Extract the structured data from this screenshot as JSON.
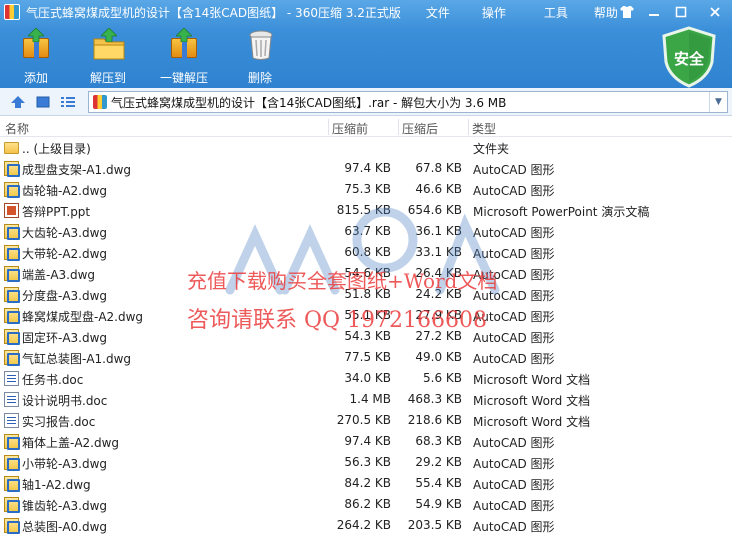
{
  "window": {
    "title": "气压式蜂窝煤成型机的设计【含14张CAD图纸】 - 360压缩 3.2正式版",
    "menu": [
      "文件",
      "操作",
      "工具",
      "帮助"
    ]
  },
  "toolbar": {
    "add_label": "添加",
    "extract_label": "解压到",
    "one_click_label": "一键解压",
    "delete_label": "删除",
    "security_label": "安全"
  },
  "addressbar": {
    "path": "气压式蜂窝煤成型机的设计【含14张CAD图纸】.rar - 解包大小为 3.6 MB"
  },
  "columns": {
    "name": "名称",
    "size": "压缩前",
    "packed": "压缩后",
    "type": "类型"
  },
  "files": [
    {
      "icon": "folder",
      "name": ".. (上级目录)",
      "size": "",
      "packed": "",
      "type": "文件夹"
    },
    {
      "icon": "dwg",
      "name": "成型盘支架-A1.dwg",
      "size": "97.4 KB",
      "packed": "67.8 KB",
      "type": "AutoCAD 图形"
    },
    {
      "icon": "dwg",
      "name": "齿轮轴-A2.dwg",
      "size": "75.3 KB",
      "packed": "46.6 KB",
      "type": "AutoCAD 图形"
    },
    {
      "icon": "ppt",
      "name": "答辩PPT.ppt",
      "size": "815.5 KB",
      "packed": "654.6 KB",
      "type": "Microsoft PowerPoint 演示文稿"
    },
    {
      "icon": "dwg",
      "name": "大齿轮-A3.dwg",
      "size": "63.7 KB",
      "packed": "36.1 KB",
      "type": "AutoCAD 图形"
    },
    {
      "icon": "dwg",
      "name": "大带轮-A2.dwg",
      "size": "60.8 KB",
      "packed": "33.1 KB",
      "type": "AutoCAD 图形"
    },
    {
      "icon": "dwg",
      "name": "端盖-A3.dwg",
      "size": "54.6 KB",
      "packed": "26.4 KB",
      "type": "AutoCAD 图形"
    },
    {
      "icon": "dwg",
      "name": "分度盘-A3.dwg",
      "size": "51.8 KB",
      "packed": "24.2 KB",
      "type": "AutoCAD 图形"
    },
    {
      "icon": "dwg",
      "name": "蜂窝煤成型盘-A2.dwg",
      "size": "55.1 KB",
      "packed": "27.9 KB",
      "type": "AutoCAD 图形"
    },
    {
      "icon": "dwg",
      "name": "固定环-A3.dwg",
      "size": "54.3 KB",
      "packed": "27.2 KB",
      "type": "AutoCAD 图形"
    },
    {
      "icon": "dwg",
      "name": "气缸总装图-A1.dwg",
      "size": "77.5 KB",
      "packed": "49.0 KB",
      "type": "AutoCAD 图形"
    },
    {
      "icon": "doc",
      "name": "任务书.doc",
      "size": "34.0 KB",
      "packed": "5.6 KB",
      "type": "Microsoft Word 文档"
    },
    {
      "icon": "doc",
      "name": "设计说明书.doc",
      "size": "1.4 MB",
      "packed": "468.3 KB",
      "type": "Microsoft Word 文档"
    },
    {
      "icon": "doc",
      "name": "实习报告.doc",
      "size": "270.5 KB",
      "packed": "218.6 KB",
      "type": "Microsoft Word 文档"
    },
    {
      "icon": "dwg",
      "name": "箱体上盖-A2.dwg",
      "size": "97.4 KB",
      "packed": "68.3 KB",
      "type": "AutoCAD 图形"
    },
    {
      "icon": "dwg",
      "name": "小带轮-A3.dwg",
      "size": "56.3 KB",
      "packed": "29.2 KB",
      "type": "AutoCAD 图形"
    },
    {
      "icon": "dwg",
      "name": "轴1-A2.dwg",
      "size": "84.2 KB",
      "packed": "55.4 KB",
      "type": "AutoCAD 图形"
    },
    {
      "icon": "dwg",
      "name": "锥齿轮-A3.dwg",
      "size": "86.2 KB",
      "packed": "54.9 KB",
      "type": "AutoCAD 图形"
    },
    {
      "icon": "dwg",
      "name": "总装图-A0.dwg",
      "size": "264.2 KB",
      "packed": "203.5 KB",
      "type": "AutoCAD 图形"
    }
  ],
  "watermark": {
    "line1": "充值下载购买全套图纸+Word文档",
    "line2": "咨询请联系   QQ 1972166608"
  },
  "colors": {
    "toolbar_blue": "#3b8fd9",
    "watermark_red": "#eb3c3c",
    "shield_green": "#3aa646"
  }
}
